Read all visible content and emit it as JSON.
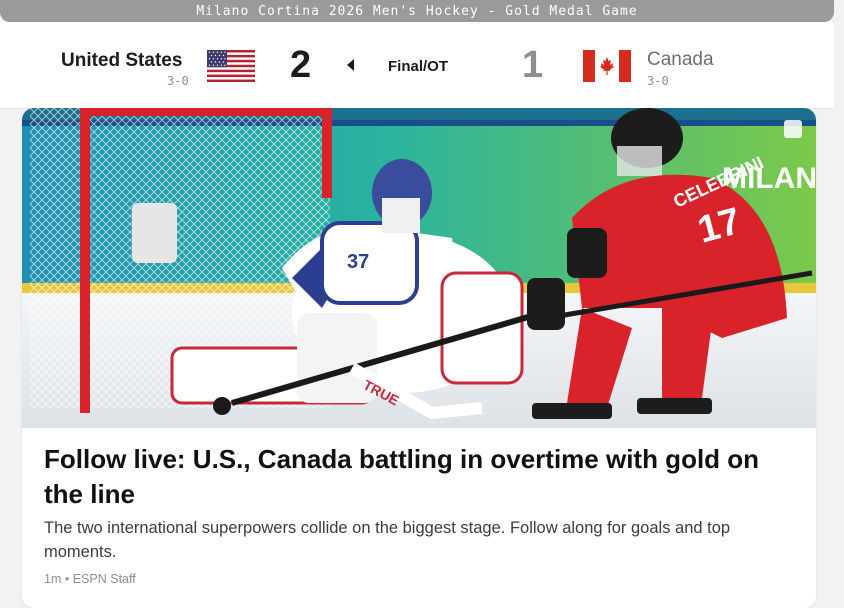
{
  "banner": {
    "title": "Milano Cortina 2026 Men's Hockey - Gold Medal Game"
  },
  "scoreboard": {
    "home": {
      "name": "United States",
      "record": "3-0",
      "score": "2",
      "flag": "us-flag-icon"
    },
    "away": {
      "name": "Canada",
      "record": "3-0",
      "score": "1",
      "flag": "canada-flag-icon"
    },
    "status": "Final/OT",
    "winner_indicator": "left-arrow-icon"
  },
  "article": {
    "image": "hockey-goalie-vs-forward-photo",
    "headline": "Follow live: U.S., Canada battling in overtime with gold on the line",
    "summary": "The two international superpowers collide on the biggest stage. Follow along for goals and top moments.",
    "time": "1m",
    "author": "ESPN Staff",
    "photo_text": {
      "rink_board": "MILANO",
      "jersey_away": "CELEBRINI",
      "jersey_away_number": "17",
      "jersey_home_number": "37",
      "stick_brand": "TRUE"
    }
  },
  "colors": {
    "banner": "#9a9a9c",
    "us_red": "#b22234",
    "us_blue": "#3c3b6e",
    "canada_red": "#d52b1e"
  }
}
